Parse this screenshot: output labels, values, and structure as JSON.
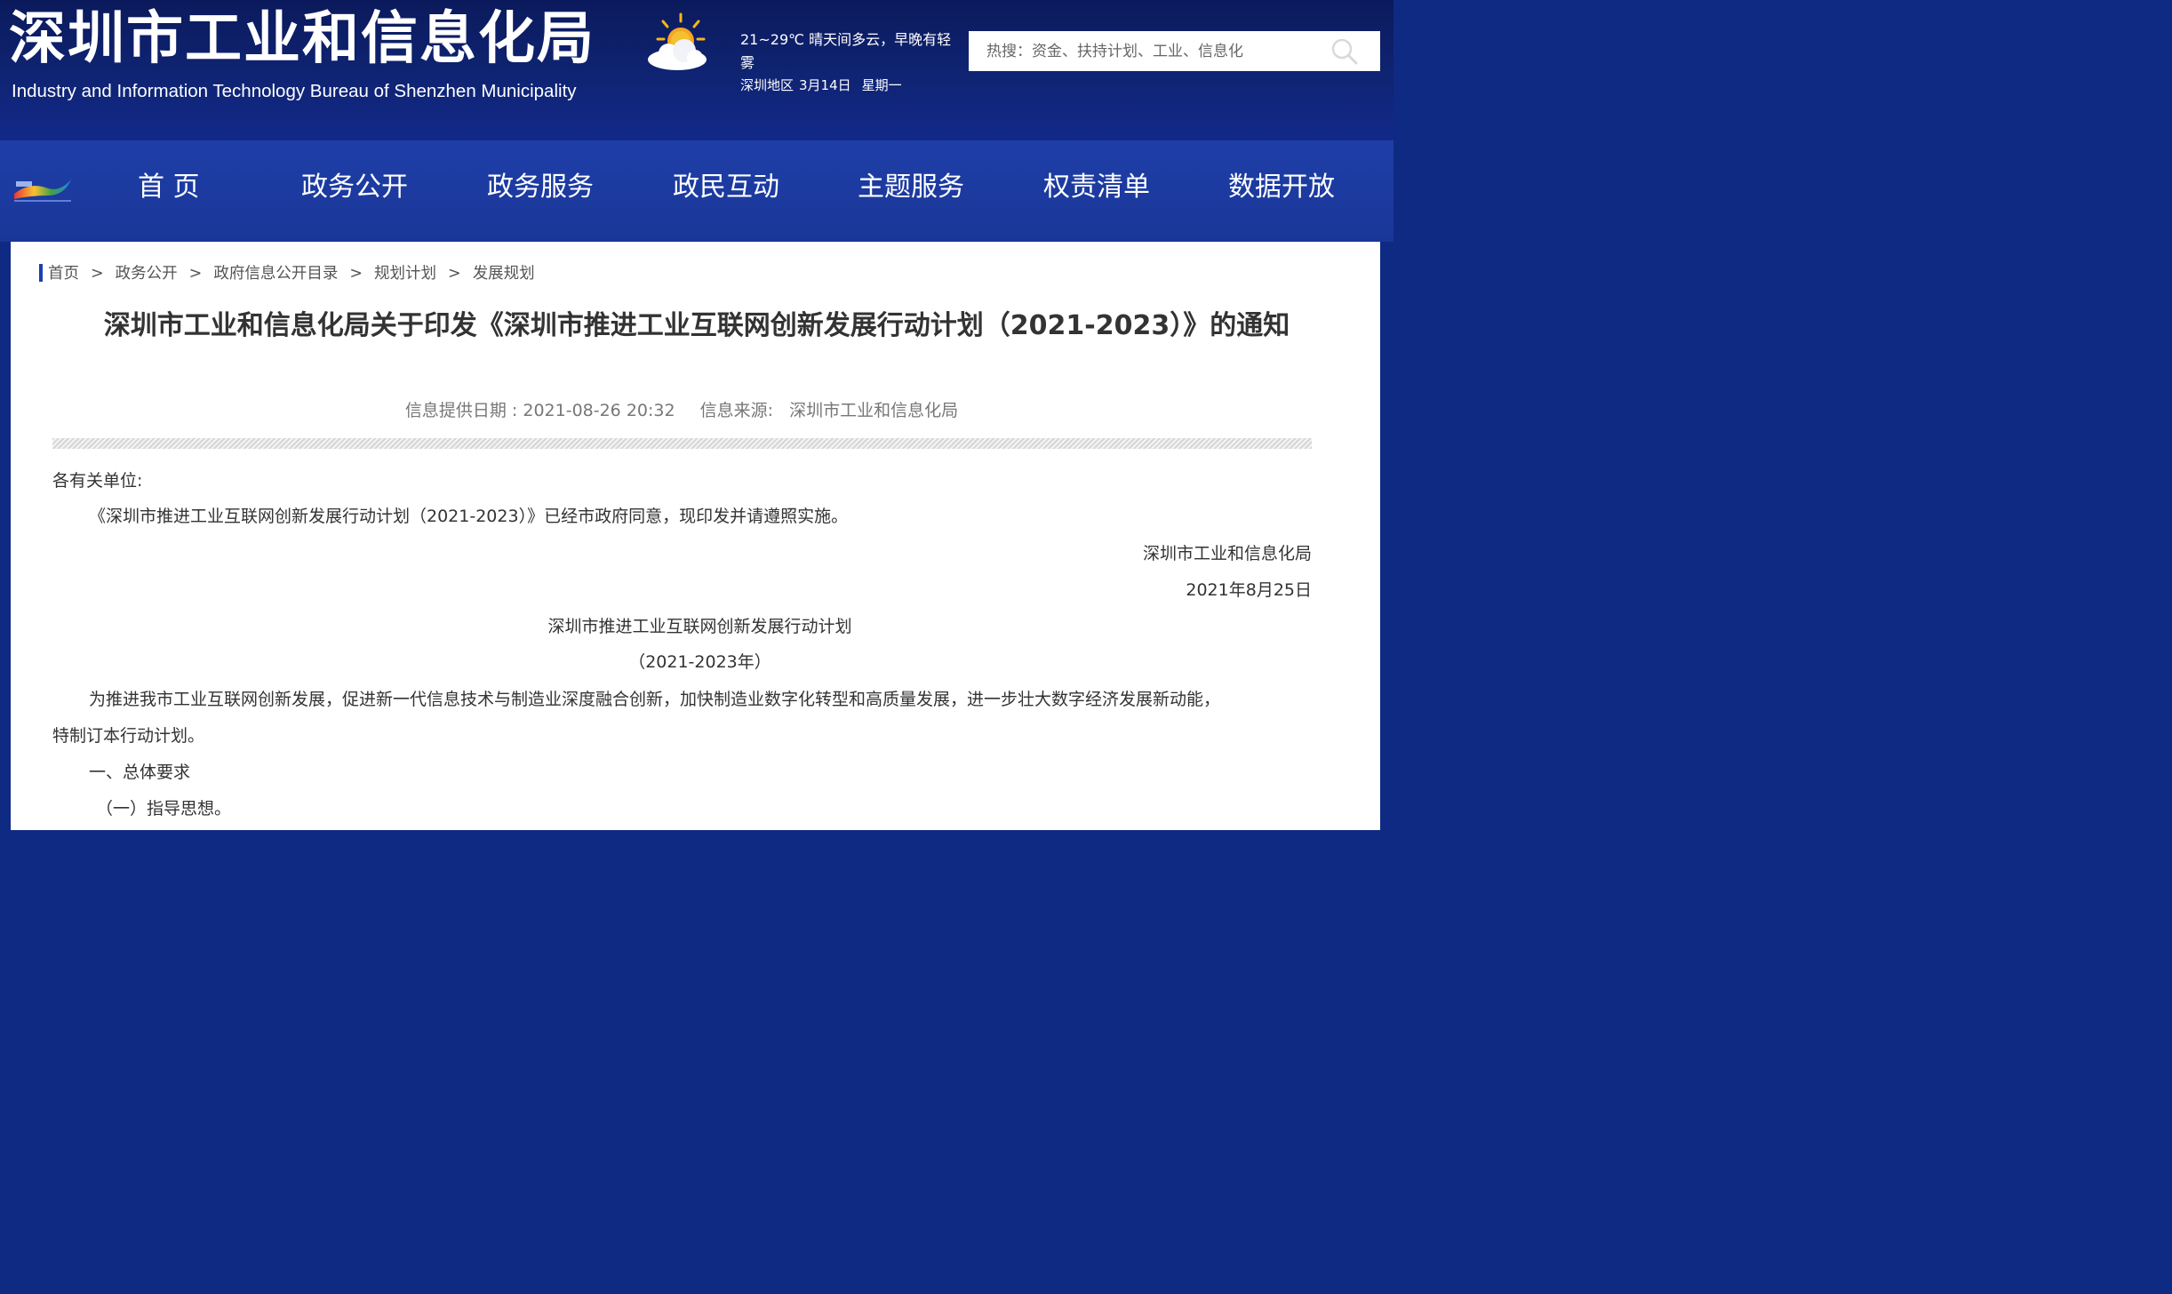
{
  "header": {
    "title": "深圳市工业和信息化局",
    "subtitle": "Industry and Information Technology Bureau of Shenzhen Municipality",
    "weather": {
      "icon": "sun-cloud-icon",
      "forecast": "21~29℃  晴天间多云，早晚有轻雾",
      "region": "深圳地区",
      "date": "3月14日",
      "weekday": "星期一"
    },
    "search": {
      "placeholder": "热搜：资金、扶持计划、工业、信息化",
      "icon": "search-icon"
    }
  },
  "nav": {
    "logo": "shenzhen-logo-icon",
    "items": [
      "首 页",
      "政务公开",
      "政务服务",
      "政民互动",
      "主题服务",
      "权责清单",
      "数据开放"
    ]
  },
  "breadcrumb": [
    "首页",
    "政务公开",
    "政府信息公开目录",
    "规划计划",
    "发展规划"
  ],
  "breadcrumb_separator": ">",
  "article": {
    "title": "深圳市工业和信息化局关于印发《深圳市推进工业互联网创新发展行动计划（2021-2023）》的通知",
    "meta_date": "信息提供日期 : 2021-08-26 20:32",
    "meta_source": "信息来源:   深圳市工业和信息化局",
    "salutation": "各有关单位:",
    "para1": "《深圳市推进工业互联网创新发展行动计划（2021-2023）》已经市政府同意，现印发并请遵照实施。",
    "sign_org": "深圳市工业和信息化局",
    "sign_date": "2021年8月25日",
    "plan_title": "深圳市推进工业互联网创新发展行动计划",
    "plan_years": "（2021-2023年）",
    "para2a": "为推进我市工业互联网创新发展，促进新一代信息技术与制造业深度融合创新，加快制造业数字化转型和高质量发展，进一步壮大数字经济发展新动能，",
    "para2b": "特制订本行动计划。",
    "section1": "一、总体要求",
    "section1_1": "（一）指导思想。"
  },
  "colors": {
    "header_bg": "#0f2473",
    "nav_bg": "#1e3fa8",
    "accent": "#1a3fb3"
  }
}
